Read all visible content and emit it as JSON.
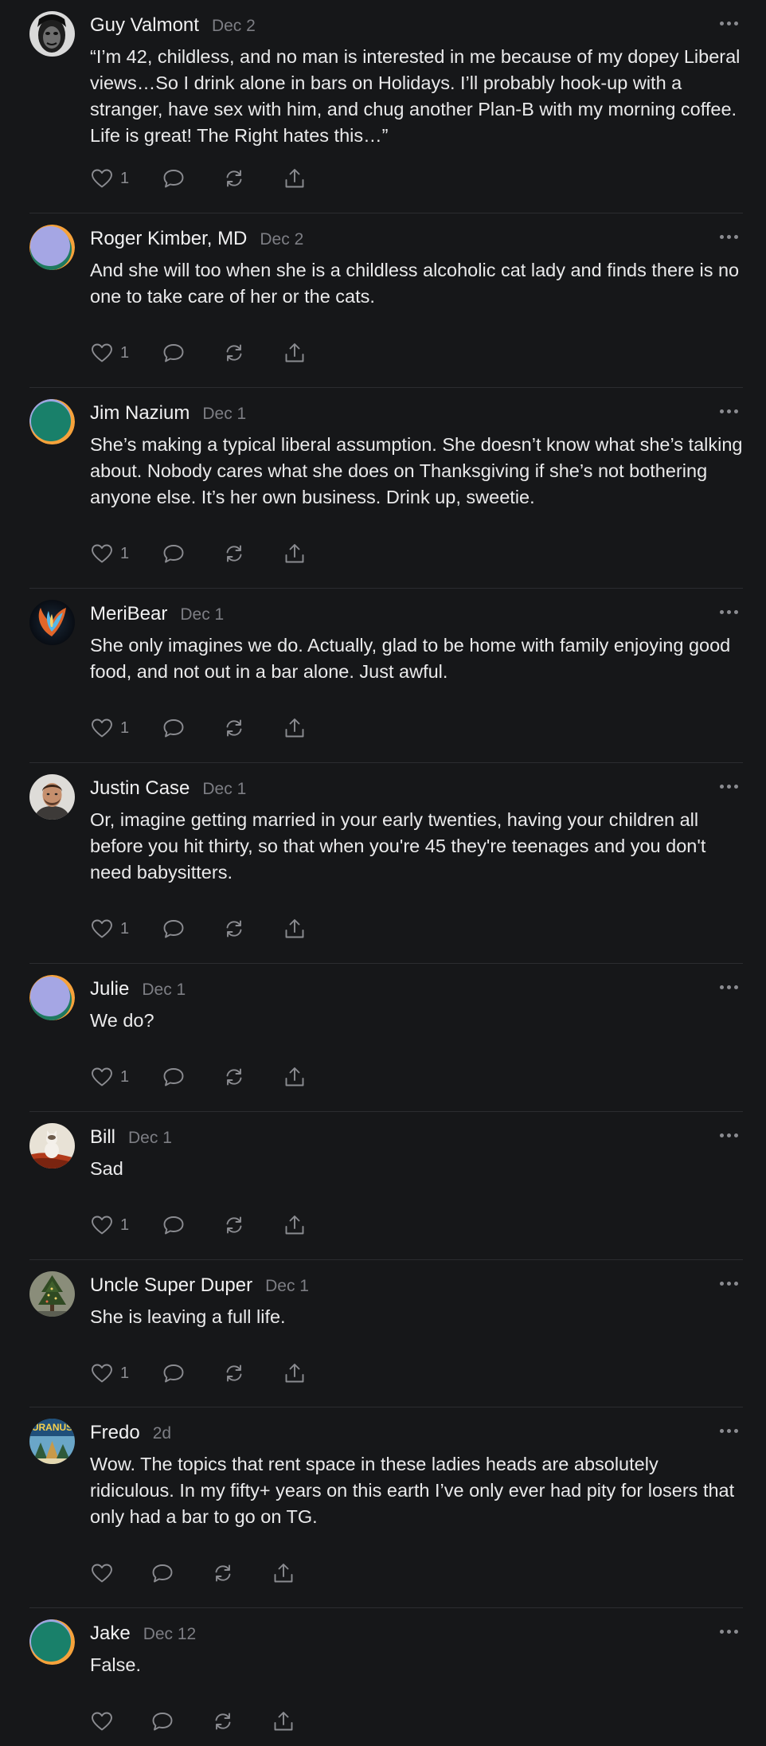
{
  "comments": [
    {
      "author": "Guy Valmont",
      "date": "Dec 2",
      "avatar": "portrait-icon",
      "text": "“I’m 42, childless, and no man is interested in me because of my dopey Liberal views…So I drink alone in bars on Holidays. I’ll probably hook-up with a stranger, have sex with him, and chug another Plan-B with my morning coffee. Life is great! The Right hates this…”",
      "likes": "1"
    },
    {
      "author": "Roger Kimber, MD",
      "date": "Dec 2",
      "avatar": "default-avatar-purple",
      "text": "And she will too when she is a childless alcoholic cat lady and finds there is no one to take care of her or the cats.",
      "likes": "1"
    },
    {
      "author": "Jim Nazium",
      "date": "Dec 1",
      "avatar": "default-avatar-green",
      "text": "She’s making a typical liberal assumption. She doesn’t know what she’s talking about. Nobody cares what she does on Thanksgiving if she’s not bothering anyone else. It’s her own business. Drink up, sweetie.",
      "likes": "1"
    },
    {
      "author": "MeriBear",
      "date": "Dec 1",
      "avatar": "phoenix-avatar",
      "text": "She only imagines we do. Actually, glad to be home with family enjoying good food, and not out in a bar alone. Just awful.",
      "likes": "1"
    },
    {
      "author": "Justin Case",
      "date": "Dec 1",
      "avatar": "man-photo-avatar",
      "text": "Or, imagine getting married in your early twenties, having your children all before you hit thirty, so that when you're 45 they're teenages and you don't need babysitters.",
      "likes": "1"
    },
    {
      "author": "Julie",
      "date": "Dec 1",
      "avatar": "default-avatar-purple",
      "text": "We do?",
      "likes": "1"
    },
    {
      "author": "Bill",
      "date": "Dec 1",
      "avatar": "cat-photo-avatar",
      "text": "Sad",
      "likes": "1"
    },
    {
      "author": "Uncle Super Duper",
      "date": "Dec 1",
      "avatar": "tree-photo-avatar",
      "text": "She is leaving a full life.",
      "likes": "1"
    },
    {
      "author": "Fredo",
      "date": "2d",
      "avatar": "uranus-poster-avatar",
      "avatar_text": "URANUS",
      "text": "Wow. The topics that rent space in these ladies heads are absolutely ridiculous. In my fifty+ years on this earth I’ve only ever had pity for losers that only had a bar to go on TG.",
      "likes": ""
    },
    {
      "author": "Jake",
      "date": "Dec 12",
      "avatar": "default-avatar-green",
      "text": "False.",
      "likes": ""
    }
  ],
  "colors": {
    "background": "#161719",
    "text": "#eaeaeb",
    "muted": "#7d7e84",
    "icon": "#8b8c91",
    "divider": "#2b2c30"
  },
  "icons": {
    "like": "heart-icon",
    "reply": "speech-bubble-icon",
    "restack": "restack-arrows-icon",
    "share": "share-upload-icon",
    "more": "more-dots-icon"
  }
}
